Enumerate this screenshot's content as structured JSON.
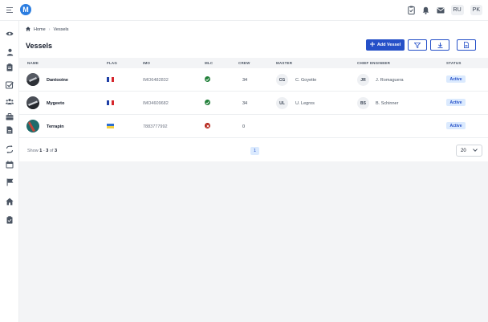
{
  "app": {
    "logo_letter": "M"
  },
  "topbar": {
    "icons": [
      "clipboard-check-icon",
      "bell-icon",
      "mail-icon"
    ],
    "lang1": "RU",
    "lang2": "PK"
  },
  "sidebar": {
    "icons": [
      "eye-icon",
      "user-icon",
      "clipboard-icon",
      "check-square-icon",
      "users-icon",
      "briefcase-icon",
      "document-icon",
      "repeat-icon",
      "calendar-icon",
      "flag-icon",
      "home-icon",
      "clipboard-list-icon"
    ]
  },
  "breadcrumb": {
    "home": "Home",
    "current": "Vessels"
  },
  "page": {
    "title": "Vessels"
  },
  "toolbar": {
    "add_label": "Add Vessel"
  },
  "table": {
    "headers": {
      "name": "NAME",
      "flag": "FLAG",
      "imo": "IMO",
      "mlc": "MLC",
      "crew": "CREW",
      "master": "MASTER",
      "chief": "CHIEF ENGINEER",
      "status": "STATUS"
    },
    "rows": [
      {
        "name": "Dantooine",
        "flag": "france",
        "imo": "IMO6482832",
        "mlc": "ok",
        "crew": "34",
        "master_initials": "CG",
        "master": "C. Goyette",
        "chief_initials": "JR",
        "chief": "J. Romaguera",
        "status": "Active",
        "avatar_color": "#3a3d44"
      },
      {
        "name": "Mygeeto",
        "flag": "france",
        "imo": "IMO4609682",
        "mlc": "ok",
        "crew": "34",
        "master_initials": "UL",
        "master": "U. Legros",
        "chief_initials": "BS",
        "chief": "B. Schinner",
        "status": "Active",
        "avatar_color": "#2f3238"
      },
      {
        "name": "Terrapin",
        "flag": "ukraine",
        "imo": "7883777992",
        "mlc": "error",
        "crew": "0",
        "master_initials": "",
        "master": "",
        "chief_initials": "",
        "chief": "",
        "status": "Active",
        "avatar_color": "#1f6b6b"
      }
    ]
  },
  "footer": {
    "show_prefix": "Show",
    "range_start": "1",
    "range_sep": " - ",
    "range_end": "3",
    "of_label": " of ",
    "total": "3",
    "page": "1",
    "per_page": "20"
  },
  "colors": {
    "primary": "#2550c8",
    "success": "#22803a",
    "danger": "#b42318"
  }
}
